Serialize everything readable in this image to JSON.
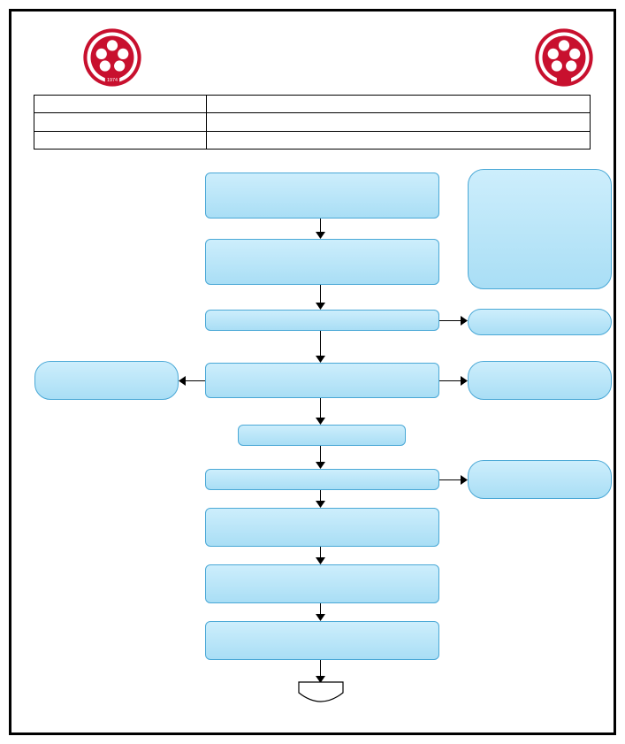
{
  "header": {
    "title_line1": "",
    "title_line2": ""
  },
  "info_rows": [
    {
      "label": "",
      "value": ""
    },
    {
      "label": "",
      "value": ""
    },
    {
      "label": "",
      "value": ""
    }
  ],
  "legend": {
    "title": "",
    "lines": [
      "",
      "",
      "",
      "",
      "",
      "",
      ""
    ]
  },
  "steps": {
    "s1": "",
    "s2": "",
    "s3": "",
    "s4": "",
    "s5": "",
    "s6": "",
    "s7": "",
    "s8": "",
    "s9": ""
  },
  "side": {
    "left1": "",
    "right1": "",
    "right2": "",
    "right3": ""
  },
  "logo_year": "1974"
}
